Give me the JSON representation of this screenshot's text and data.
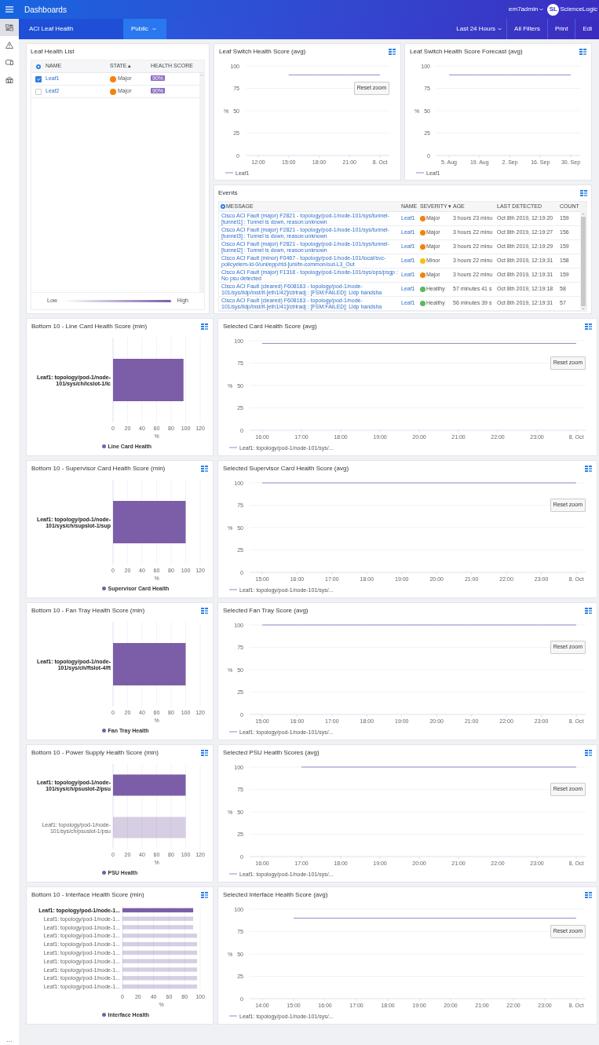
{
  "header": {
    "title": "Dashboards",
    "user": "em7admin",
    "logo_mark": "SL",
    "logo_text": "ScienceLogic"
  },
  "toolbar": {
    "dashboard": "ACI Leaf Health",
    "visibility": "Public",
    "time_range": "Last 24 Hours",
    "buttons": [
      "All Filters",
      "Print",
      "Edi"
    ]
  },
  "sidebar": {
    "items": [
      {
        "kind": "dashboards",
        "selected": true
      },
      {
        "kind": "alerts",
        "selected": false
      },
      {
        "kind": "devices",
        "selected": false
      },
      {
        "kind": "organizations",
        "selected": false
      }
    ],
    "more": "···"
  },
  "leaf_health_list": {
    "title": "Leaf Health List",
    "columns": [
      "NAME",
      "STATE ▴",
      "HEALTH SCORE"
    ],
    "rows": [
      {
        "checked": true,
        "name": "Leaf1",
        "state": "Major",
        "color": "#f5820b",
        "score": "90%"
      },
      {
        "checked": false,
        "name": "Leaf2",
        "state": "Major",
        "color": "#f5820b",
        "score": "90%"
      }
    ],
    "legend": {
      "low": "Low",
      "high": "High"
    }
  },
  "leaf_switch_chart": {
    "title": "Leaf Switch Health Score (avg)",
    "reset_zoom": "Reset zoom",
    "chart_data": {
      "type": "line",
      "ylabel": "%",
      "categories": [
        "12:00",
        "15:00",
        "18:00",
        "21:00",
        "8. Oct"
      ],
      "ylim": [
        0,
        100
      ],
      "yticks": [
        0,
        25,
        50,
        75,
        100
      ],
      "grid": true,
      "series": [
        {
          "name": "Leaf1",
          "color": "#9c86c9",
          "values": [
            null,
            90,
            90,
            90,
            90
          ]
        }
      ]
    }
  },
  "forecast_chart": {
    "title": "Leaf Switch Health Score Forecast (avg)",
    "chart_data": {
      "type": "line",
      "ylabel": "%",
      "categories": [
        "5. Aug",
        "19. Aug",
        "2. Sep",
        "16. Sep",
        "30. Sep"
      ],
      "ylim": [
        0,
        100
      ],
      "yticks": [
        0,
        25,
        50,
        75,
        100
      ],
      "grid": true,
      "series": [
        {
          "name": "Leaf1",
          "color": "#9c86c9",
          "values": [
            90,
            90,
            90,
            90,
            90
          ]
        }
      ]
    }
  },
  "events": {
    "title": "Events",
    "columns": [
      "MESSAGE",
      "NAME",
      "SEVERITY ▾",
      "AGE",
      "LAST DETECTED",
      "COUNT"
    ],
    "rows": [
      {
        "message": "Cisco ACI Fault (major) F2821 - topology/pod-1/node-101/sys/tunnel-[tunnel1] : Tunnel is down, reason:unknown",
        "name": "Leaf1",
        "severity": "Major",
        "color": "#f5820b",
        "age": "3 hours 23 minu",
        "last_detected": "Oct 8th 2019, 12:19:20",
        "count": "159"
      },
      {
        "message": "Cisco ACI Fault (major) F2821 - topology/pod-1/node-101/sys/tunnel-[tunnel3] : Tunnel is down, reason:unknown",
        "name": "Leaf1",
        "severity": "Major",
        "color": "#f5820b",
        "age": "3 hours 22 minu",
        "last_detected": "Oct 8th 2019, 12:19:27",
        "count": "156"
      },
      {
        "message": "Cisco ACI Fault (major) F2821 - topology/pod-1/node-101/sys/tunnel-[tunnel2] : Tunnel is down, reason:unknown",
        "name": "Leaf1",
        "severity": "Major",
        "color": "#f5820b",
        "age": "3 hours 22 minu",
        "last_detected": "Oct 8th 2019, 12:19:29",
        "count": "159"
      },
      {
        "message": "Cisco ACI Fault (minor) F0467 - topology/pod-1/node-101/local/svc-policyelem-id-0/uni/epp/rtd-[uni/tn-common/out-L3_Out",
        "name": "Leaf1",
        "severity": "Minor",
        "color": "#f5c211",
        "age": "3 hours 22 minu",
        "last_detected": "Oct 8th 2019, 12:19:31",
        "count": "158"
      },
      {
        "message": "Cisco ACI Fault (major) F1318 - topology/pod-1/node-101/sys/ops/psgp : No psu detected",
        "name": "Leaf1",
        "severity": "Major",
        "color": "#f5820b",
        "age": "3 hours 22 minu",
        "last_detected": "Oct 8th 2019, 12:19:31",
        "count": "159"
      },
      {
        "message": "Cisco ACI Fault (cleared) F608163 - topology/pod-1/node-101/sys/lldp/inst/if-[eth1/42]/ctrlradj : [FSM:FAILED]: Lldp handsha",
        "name": "Leaf1",
        "severity": "Healthy",
        "color": "#5cb85c",
        "age": "57 minutes 41 s",
        "last_detected": "Oct 8th 2019, 12:19:18",
        "count": "58"
      },
      {
        "message": "Cisco ACI Fault (cleared) F608163 - topology/pod-1/node-101/sys/lldp/inst/if-[eth1/41]/ctrlradj : [FSM:FAILED]: Lldp handsha",
        "name": "Leaf1",
        "severity": "Healthy",
        "color": "#5cb85c",
        "age": "56 minutes 39 s",
        "last_detected": "Oct 8th 2019, 12:19:31",
        "count": "57"
      }
    ]
  },
  "rows": [
    {
      "bar_panel": {
        "title": "Bottom 10 - Line Card Health Score (min)",
        "highlighted": [
          true
        ],
        "chart_data": {
          "type": "bar",
          "orientation": "horizontal",
          "xlabel": "%",
          "xlim": [
            0,
            120
          ],
          "xticks": [
            0,
            20,
            40,
            60,
            80,
            100,
            120
          ],
          "grid": true,
          "categories": [
            "Leaf1: topology/pod-1/node-101/sys/ch/lcslot-1/lc"
          ],
          "series": [
            {
              "name": "Line Card Health",
              "color": "#7b5ea7",
              "values": [
                97
              ]
            }
          ]
        }
      },
      "line_panel": {
        "title": "Selected Card Health Score (avg)",
        "reset_zoom": "Reset zoom",
        "chart_data": {
          "type": "line",
          "ylabel": "%",
          "categories": [
            "16:00",
            "17:00",
            "18:00",
            "19:00",
            "20:00",
            "21:00",
            "22:00",
            "23:00",
            "8. Oct"
          ],
          "ylim": [
            0,
            100
          ],
          "yticks": [
            0,
            25,
            50,
            75,
            100
          ],
          "grid": true,
          "series": [
            {
              "name": "Leaf1: topology/pod-1/node-101/sys/...",
              "color": "#9c86c9",
              "values": [
                97,
                97,
                97,
                97,
                97,
                97,
                97,
                97,
                97
              ]
            }
          ]
        }
      }
    },
    {
      "bar_panel": {
        "title": "Bottom 10 - Supervisor Card Health Score (min)",
        "highlighted": [
          true
        ],
        "chart_data": {
          "type": "bar",
          "orientation": "horizontal",
          "xlabel": "%",
          "xlim": [
            0,
            120
          ],
          "xticks": [
            0,
            20,
            40,
            60,
            80,
            100,
            120
          ],
          "grid": true,
          "categories": [
            "Leaf1: topology/pod-1/node-101/sys/ch/supslot-1/sup"
          ],
          "series": [
            {
              "name": "Supervisor Card Health",
              "color": "#7b5ea7",
              "values": [
                100
              ]
            }
          ]
        }
      },
      "line_panel": {
        "title": "Selected Supervisor Card Health Score (avg)",
        "reset_zoom": "Reset zoom",
        "chart_data": {
          "type": "line",
          "ylabel": "%",
          "categories": [
            "15:00",
            "16:00",
            "17:00",
            "18:00",
            "19:00",
            "20:00",
            "21:00",
            "22:00",
            "23:00",
            "8. Oct"
          ],
          "ylim": [
            0,
            100
          ],
          "yticks": [
            0,
            25,
            50,
            75,
            100
          ],
          "grid": true,
          "series": [
            {
              "name": "Leaf1: topology/pod-1/node-101/sys/...",
              "color": "#9c86c9",
              "values": [
                100,
                100,
                100,
                100,
                100,
                100,
                100,
                100,
                100,
                100
              ]
            }
          ]
        }
      }
    },
    {
      "bar_panel": {
        "title": "Bottom 10 - Fan Tray Health Score (min)",
        "highlighted": [
          true
        ],
        "chart_data": {
          "type": "bar",
          "orientation": "horizontal",
          "xlabel": "%",
          "xlim": [
            0,
            120
          ],
          "xticks": [
            0,
            20,
            40,
            60,
            80,
            100,
            120
          ],
          "grid": true,
          "categories": [
            "Leaf1: topology/pod-1/node-101/sys/ch/ftslot-4/ft"
          ],
          "series": [
            {
              "name": "Fan Tray Health",
              "color": "#7b5ea7",
              "values": [
                100
              ]
            }
          ]
        }
      },
      "line_panel": {
        "title": "Selected Fan Tray Score (avg)",
        "reset_zoom": "Reset zoom",
        "chart_data": {
          "type": "line",
          "ylabel": "%",
          "categories": [
            "15:00",
            "16:00",
            "17:00",
            "18:00",
            "19:00",
            "20:00",
            "21:00",
            "22:00",
            "23:00",
            "8. Oct"
          ],
          "ylim": [
            0,
            100
          ],
          "yticks": [
            0,
            25,
            50,
            75,
            100
          ],
          "grid": true,
          "series": [
            {
              "name": "Leaf1: topology/pod-1/node-101/sys/...",
              "color": "#9c86c9",
              "values": [
                100,
                100,
                100,
                100,
                100,
                100,
                100,
                100,
                100,
                100
              ]
            }
          ]
        }
      }
    },
    {
      "bar_panel": {
        "title": "Bottom 10 - Power Supply Health Score (min)",
        "highlighted": [
          true,
          false
        ],
        "chart_data": {
          "type": "bar",
          "orientation": "horizontal",
          "xlabel": "%",
          "xlim": [
            0,
            120
          ],
          "xticks": [
            0,
            20,
            40,
            60,
            80,
            100,
            120
          ],
          "grid": true,
          "categories": [
            "Leaf1: topology/pod-1/node-101/sys/ch/psuslot-2/psu",
            "Leaf1: topology/pod-1/node-101/sys/ch/psuslot-1/psu"
          ],
          "series": [
            {
              "name": "PSU Health",
              "color": "#7b5ea7",
              "values": [
                100,
                100
              ]
            }
          ]
        }
      },
      "line_panel": {
        "title": "Selected PSU Health Scores (avg)",
        "reset_zoom": "Reset zoom",
        "chart_data": {
          "type": "line",
          "ylabel": "%",
          "categories": [
            "16:00",
            "17:00",
            "18:00",
            "19:00",
            "20:00",
            "21:00",
            "22:00",
            "23:00",
            "8. Oct"
          ],
          "ylim": [
            0,
            100
          ],
          "yticks": [
            0,
            25,
            50,
            75,
            100
          ],
          "grid": true,
          "series": [
            {
              "name": "Leaf1: topology/pod-1/node-101/sys/...",
              "color": "#9c86c9",
              "values": [
                null,
                100,
                100,
                100,
                100,
                100,
                100,
                100,
                100
              ]
            }
          ]
        }
      }
    },
    {
      "bar_panel": {
        "title": "Bottom 10 - Interface Health Score (min)",
        "highlighted": [
          true,
          false,
          false,
          false,
          false,
          false,
          false,
          false,
          false,
          false
        ],
        "chart_data": {
          "type": "bar",
          "orientation": "horizontal",
          "xlabel": "%",
          "xlim": [
            0,
            100
          ],
          "xticks": [
            0,
            20,
            40,
            60,
            80,
            100
          ],
          "grid": true,
          "categories": [
            "Leaf1: topology/pod-1/node-1...",
            "Leaf1: topology/pod-1/node-1...",
            "Leaf1: topology/pod-1/node-1...",
            "Leaf1: topology/pod-1/node-1...",
            "Leaf1: topology/pod-1/node-1...",
            "Leaf1: topology/pod-1/node-1...",
            "Leaf1: topology/pod-1/node-1...",
            "Leaf1: topology/pod-1/node-1...",
            "Leaf1: topology/pod-1/node-1...",
            "Leaf1: topology/pod-1/node-1..."
          ],
          "series": [
            {
              "name": "Interface Health",
              "color": "#7b5ea7",
              "values": [
                91,
                91,
                91,
                96,
                96,
                96,
                96,
                96,
                96,
                96
              ]
            }
          ]
        }
      },
      "line_panel": {
        "title": "Selected Interface Health Score (avg)",
        "reset_zoom": "Reset zoom",
        "chart_data": {
          "type": "line",
          "ylabel": "%",
          "categories": [
            "14:00",
            "15:00",
            "16:00",
            "17:00",
            "18:00",
            "19:00",
            "20:00",
            "21:00",
            "22:00",
            "23:00",
            "8. Oct"
          ],
          "ylim": [
            0,
            100
          ],
          "yticks": [
            0,
            25,
            50,
            75,
            100
          ],
          "grid": true,
          "series": [
            {
              "name": "Leaf1: topology/pod-1/node-101/sys/...",
              "color": "#9c86c9",
              "values": [
                null,
                90,
                90,
                90,
                90,
                90,
                90,
                90,
                90,
                90,
                90
              ]
            }
          ]
        }
      }
    }
  ]
}
